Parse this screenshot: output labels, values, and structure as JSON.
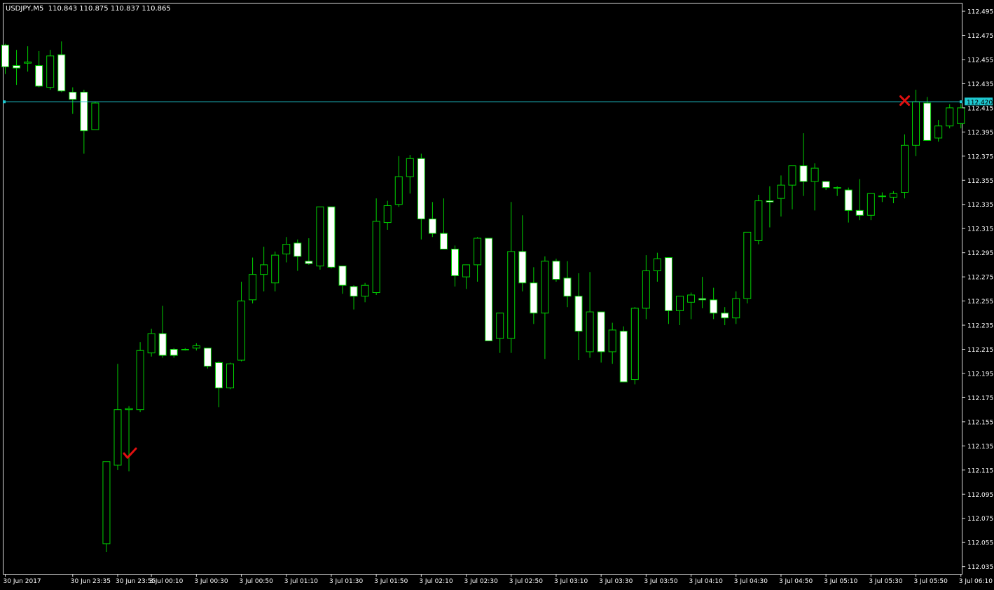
{
  "header": {
    "symbol_timeframe": "USDJPY,M5",
    "ohlc": "110.843 110.875 110.837 110.865"
  },
  "colors": {
    "background": "#000000",
    "candle_outline": "#00d000",
    "bull_body": "#000000",
    "bear_body": "#ffffff",
    "horizontal_line": "#1ec8d0",
    "marker": "#e01010",
    "axis_text": "#ffffff",
    "frame": "#d8d8d8"
  },
  "horizontal_line": {
    "label": "112.420",
    "price": 112.42
  },
  "markers": [
    {
      "name": "entry-check-marker",
      "symbol": "check-mark",
      "glyph": "✓",
      "candle_index": 11,
      "price": 112.127
    },
    {
      "name": "exit-x-marker",
      "symbol": "x-mark",
      "glyph": "✕",
      "candle_index": 80,
      "price": 112.421
    }
  ],
  "chart_data": {
    "type": "candlestick",
    "instrument": "USDJPY",
    "timeframe": "M5",
    "y_axis_side": "right",
    "ylim": [
      112.029,
      112.502
    ],
    "grid": false,
    "y_ticks": [
      "112.495",
      "112.475",
      "112.455",
      "112.435",
      "112.415",
      "112.395",
      "112.375",
      "112.355",
      "112.335",
      "112.315",
      "112.295",
      "112.275",
      "112.255",
      "112.235",
      "112.215",
      "112.195",
      "112.175",
      "112.155",
      "112.135",
      "112.115",
      "112.095",
      "112.075",
      "112.055",
      "112.035"
    ],
    "x_ticks": [
      {
        "label": "30 Jun 2017",
        "candle_index": 0
      },
      {
        "label": "30 Jun 23:35",
        "candle_index": 6
      },
      {
        "label": "30 Jun 23:55",
        "candle_index": 10
      },
      {
        "label": "3 Jul 00:10",
        "candle_index": 13
      },
      {
        "label": "3 Jul 00:30",
        "candle_index": 17
      },
      {
        "label": "3 Jul 00:50",
        "candle_index": 21
      },
      {
        "label": "3 Jul 01:10",
        "candle_index": 25
      },
      {
        "label": "3 Jul 01:30",
        "candle_index": 29
      },
      {
        "label": "3 Jul 01:50",
        "candle_index": 33
      },
      {
        "label": "3 Jul 02:10",
        "candle_index": 37
      },
      {
        "label": "3 Jul 02:30",
        "candle_index": 41
      },
      {
        "label": "3 Jul 02:50",
        "candle_index": 45
      },
      {
        "label": "3 Jul 03:10",
        "candle_index": 49
      },
      {
        "label": "3 Jul 03:30",
        "candle_index": 53
      },
      {
        "label": "3 Jul 03:50",
        "candle_index": 57
      },
      {
        "label": "3 Jul 04:10",
        "candle_index": 61
      },
      {
        "label": "3 Jul 04:30",
        "candle_index": 65
      },
      {
        "label": "3 Jul 04:50",
        "candle_index": 69
      },
      {
        "label": "3 Jul 05:10",
        "candle_index": 73
      },
      {
        "label": "3 Jul 05:30",
        "candle_index": 77
      },
      {
        "label": "3 Jul 05:50",
        "candle_index": 81
      },
      {
        "label": "3 Jul 06:10",
        "candle_index": 85
      }
    ],
    "candles": [
      [
        112.467,
        112.468,
        112.443,
        112.449
      ],
      [
        112.45,
        112.463,
        112.434,
        112.448
      ],
      [
        112.452,
        112.466,
        112.445,
        112.453
      ],
      [
        112.45,
        112.462,
        112.432,
        112.433
      ],
      [
        112.432,
        112.463,
        112.43,
        112.458
      ],
      [
        112.459,
        112.47,
        112.428,
        112.429
      ],
      [
        112.428,
        112.432,
        112.41,
        112.422
      ],
      [
        112.428,
        112.43,
        112.377,
        112.396
      ],
      [
        112.397,
        112.42,
        112.397,
        112.419
      ],
      [
        112.054,
        112.122,
        112.047,
        112.122
      ],
      [
        112.119,
        112.203,
        112.115,
        112.165
      ],
      [
        112.165,
        112.168,
        112.114,
        112.166
      ],
      [
        112.165,
        112.221,
        112.163,
        112.214
      ],
      [
        112.212,
        112.232,
        112.209,
        112.228
      ],
      [
        112.228,
        112.251,
        112.208,
        112.21
      ],
      [
        112.215,
        112.216,
        112.208,
        112.21
      ],
      [
        112.215,
        112.216,
        112.214,
        112.215
      ],
      [
        112.216,
        112.22,
        112.214,
        112.218
      ],
      [
        112.216,
        112.216,
        112.199,
        112.201
      ],
      [
        112.204,
        112.205,
        112.167,
        112.183
      ],
      [
        112.183,
        112.204,
        112.182,
        112.203
      ],
      [
        112.206,
        112.271,
        112.205,
        112.255
      ],
      [
        112.256,
        112.291,
        112.253,
        112.277
      ],
      [
        112.277,
        112.3,
        112.263,
        112.285
      ],
      [
        112.27,
        112.296,
        112.263,
        112.293
      ],
      [
        112.294,
        112.308,
        112.287,
        112.302
      ],
      [
        112.303,
        112.306,
        112.28,
        112.292
      ],
      [
        112.288,
        112.307,
        112.285,
        112.286
      ],
      [
        112.284,
        112.332,
        112.281,
        112.333
      ],
      [
        112.333,
        112.332,
        112.282,
        112.283
      ],
      [
        112.284,
        112.284,
        112.261,
        112.268
      ],
      [
        112.267,
        112.268,
        112.248,
        112.259
      ],
      [
        112.259,
        112.27,
        112.254,
        112.268
      ],
      [
        112.262,
        112.34,
        112.26,
        112.321
      ],
      [
        112.32,
        112.338,
        112.314,
        112.334
      ],
      [
        112.335,
        112.375,
        112.333,
        112.358
      ],
      [
        112.358,
        112.376,
        112.344,
        112.373
      ],
      [
        112.373,
        112.377,
        112.306,
        112.323
      ],
      [
        112.323,
        112.337,
        112.308,
        112.311
      ],
      [
        112.311,
        112.34,
        112.299,
        112.298
      ],
      [
        112.298,
        112.301,
        112.267,
        112.276
      ],
      [
        112.275,
        112.285,
        112.265,
        112.285
      ],
      [
        112.285,
        112.308,
        112.271,
        112.307
      ],
      [
        112.307,
        112.307,
        112.222,
        112.222
      ],
      [
        112.224,
        112.245,
        112.212,
        112.245
      ],
      [
        112.224,
        112.337,
        112.212,
        112.296
      ],
      [
        112.296,
        112.326,
        112.263,
        112.27
      ],
      [
        112.27,
        112.283,
        112.236,
        112.245
      ],
      [
        112.245,
        112.292,
        112.207,
        112.288
      ],
      [
        112.288,
        112.29,
        112.271,
        112.273
      ],
      [
        112.274,
        112.288,
        112.25,
        112.259
      ],
      [
        112.259,
        112.278,
        112.206,
        112.23
      ],
      [
        112.213,
        112.279,
        112.208,
        112.246
      ],
      [
        112.246,
        112.245,
        112.204,
        112.213
      ],
      [
        112.213,
        112.237,
        112.203,
        112.231
      ],
      [
        112.23,
        112.234,
        112.189,
        112.188
      ],
      [
        112.19,
        112.25,
        112.186,
        112.249
      ],
      [
        112.249,
        112.293,
        112.24,
        112.28
      ],
      [
        112.28,
        112.295,
        112.271,
        112.29
      ],
      [
        112.291,
        112.291,
        112.236,
        112.247
      ],
      [
        112.247,
        112.257,
        112.235,
        112.259
      ],
      [
        112.254,
        112.262,
        112.24,
        112.26
      ],
      [
        112.257,
        112.275,
        112.249,
        112.256
      ],
      [
        112.256,
        112.266,
        112.24,
        112.245
      ],
      [
        112.245,
        112.25,
        112.235,
        112.241
      ],
      [
        112.241,
        112.263,
        112.236,
        112.257
      ],
      [
        112.257,
        112.311,
        112.253,
        112.312
      ],
      [
        112.305,
        112.343,
        112.302,
        112.338
      ],
      [
        112.338,
        112.35,
        112.316,
        112.337
      ],
      [
        112.34,
        112.359,
        112.325,
        112.351
      ],
      [
        112.351,
        112.365,
        112.331,
        112.367
      ],
      [
        112.367,
        112.394,
        112.342,
        112.354
      ],
      [
        112.354,
        112.369,
        112.33,
        112.365
      ],
      [
        112.354,
        112.354,
        112.347,
        112.349
      ],
      [
        112.349,
        112.35,
        112.342,
        112.349
      ],
      [
        112.347,
        112.349,
        112.32,
        112.33
      ],
      [
        112.33,
        112.356,
        112.322,
        112.326
      ],
      [
        112.326,
        112.344,
        112.322,
        112.344
      ],
      [
        112.342,
        112.345,
        112.337,
        112.342
      ],
      [
        112.341,
        112.346,
        112.336,
        112.344
      ],
      [
        112.345,
        112.393,
        112.34,
        112.384
      ],
      [
        112.384,
        112.43,
        112.375,
        112.42
      ],
      [
        112.419,
        112.424,
        112.388,
        112.388
      ],
      [
        112.39,
        112.405,
        112.387,
        112.4
      ],
      [
        112.4,
        112.418,
        112.398,
        112.415
      ],
      [
        112.402,
        112.418,
        112.398,
        112.415
      ]
    ]
  }
}
